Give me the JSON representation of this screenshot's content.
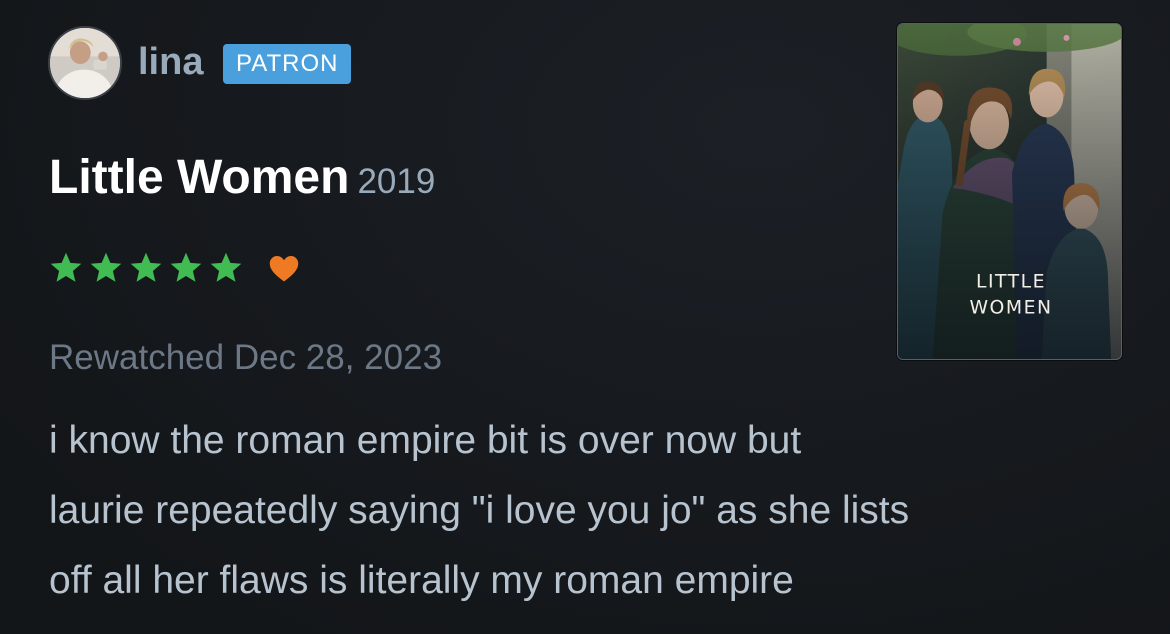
{
  "user": {
    "name": "lina",
    "badge": "PATRON"
  },
  "film": {
    "title": "Little Women",
    "year": "2019",
    "poster_text_line1": "LITTLE",
    "poster_text_line2": "WOMEN"
  },
  "rating": {
    "stars": 5,
    "max_stars": 5,
    "liked": true,
    "star_icon": "star-icon",
    "like_icon": "heart-icon"
  },
  "review": {
    "watched_label": "Rewatched Dec 28, 2023",
    "lines": [
      "i know the roman empire bit is over now but",
      "laurie repeatedly saying \"i love you jo\" as she lists",
      "off all her flaws is literally my roman empire"
    ]
  },
  "colors": {
    "background": "#15181c",
    "star": "#40bc53",
    "heart": "#ee7a24",
    "badge": "#4aa0dd",
    "muted": "#99aabb"
  }
}
